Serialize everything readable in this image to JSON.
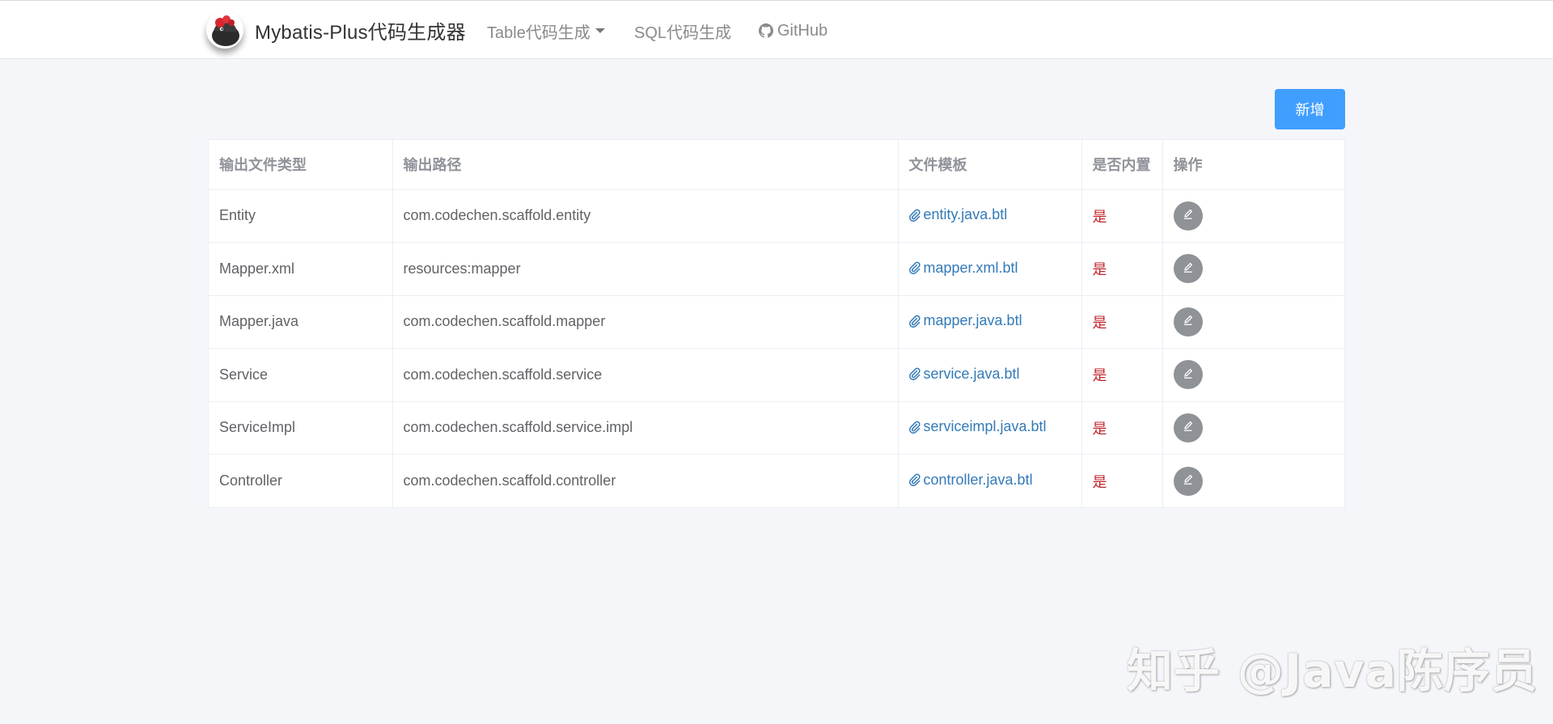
{
  "navbar": {
    "brand": "Mybatis-Plus代码生成器",
    "items": [
      {
        "label": "Table代码生成",
        "dropdown": true
      },
      {
        "label": "SQL代码生成"
      },
      {
        "label": "GitHub",
        "icon": "github-icon"
      }
    ]
  },
  "toolbar": {
    "add_label": "新增"
  },
  "table": {
    "headers": [
      "输出文件类型",
      "输出路径",
      "文件模板",
      "是否内置",
      "操作"
    ],
    "rows": [
      {
        "type": "Entity",
        "path": "com.codechen.scaffold.entity",
        "template": "entity.java.btl",
        "builtin": "是"
      },
      {
        "type": "Mapper.xml",
        "path": "resources:mapper",
        "template": "mapper.xml.btl",
        "builtin": "是"
      },
      {
        "type": "Mapper.java",
        "path": "com.codechen.scaffold.mapper",
        "template": "mapper.java.btl",
        "builtin": "是"
      },
      {
        "type": "Service",
        "path": "com.codechen.scaffold.service",
        "template": "service.java.btl",
        "builtin": "是"
      },
      {
        "type": "ServiceImpl",
        "path": "com.codechen.scaffold.service.impl",
        "template": "serviceimpl.java.btl",
        "builtin": "是"
      },
      {
        "type": "Controller",
        "path": "com.codechen.scaffold.controller",
        "template": "controller.java.btl",
        "builtin": "是"
      }
    ]
  },
  "watermark": "知乎 @Java陈序员",
  "colors": {
    "primary_button": "#409eff",
    "link": "#337ab7",
    "builtin_text": "#c0262d",
    "edit_button": "#8f9296",
    "page_background": "#f5f6fa"
  },
  "icons": {
    "template_link": "paperclip-icon",
    "action": "edit-icon",
    "logo": "logo-icon"
  }
}
